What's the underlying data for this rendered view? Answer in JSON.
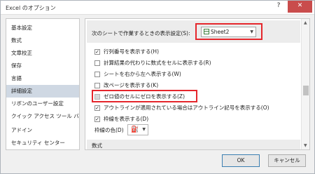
{
  "window": {
    "title": "Excel のオプション",
    "help": "?",
    "close": "✕"
  },
  "sidebar": {
    "items": [
      {
        "label": "基本設定"
      },
      {
        "label": "数式"
      },
      {
        "label": "文章校正"
      },
      {
        "label": "保存"
      },
      {
        "label": "言語"
      },
      {
        "label": "詳細設定"
      },
      {
        "label": "リボンのユーザー設定"
      },
      {
        "label": "クイック アクセス ツール バー"
      },
      {
        "label": "アドイン"
      },
      {
        "label": "セキュリティ センター"
      }
    ],
    "active_index": 5
  },
  "main": {
    "section_label": "次のシートで作業するときの表示設定(S):",
    "sheet_select": {
      "value": "Sheet2"
    },
    "options": [
      {
        "label": "行列番号を表示する(H)",
        "checked": true,
        "disabled": false
      },
      {
        "label": "計算結果の代わりに数式をセルに表示する(R)",
        "checked": false,
        "disabled": false
      },
      {
        "label": "シートを右から左へ表示する(W)",
        "checked": false,
        "disabled": false
      },
      {
        "label": "改ページを表示する(K)",
        "checked": false,
        "disabled": false
      },
      {
        "label": "ゼロ値のセルにゼロを表示する(Z)",
        "checked": false,
        "disabled": true
      },
      {
        "label": "アウトラインが適用されている場合はアウトライン記号を表示する(O)",
        "checked": true,
        "disabled": false
      },
      {
        "label": "枠線を表示する(D)",
        "checked": true,
        "disabled": false
      }
    ],
    "gridline_color_label": "枠線の色(D)",
    "lower_section_label": "数式"
  },
  "footer": {
    "ok": "OK",
    "cancel": "キャンセル"
  },
  "colors": {
    "highlight": "#e5262c",
    "active_bg": "#cfd8e3"
  },
  "icons": {
    "sheet": "sheet-icon",
    "paint": "paint-bucket-icon"
  }
}
